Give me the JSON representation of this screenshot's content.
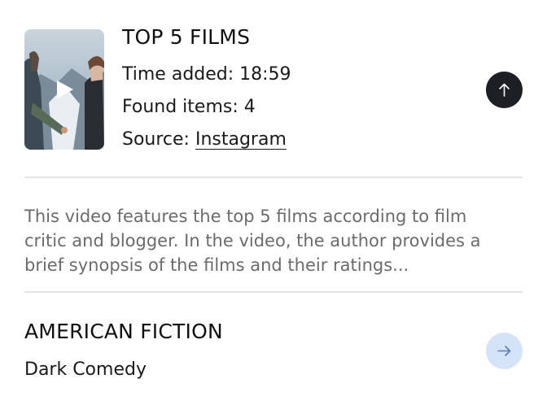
{
  "video": {
    "title": "TOP 5 FILMS",
    "time_added": "Time added: 18:59",
    "found_items": "Found items: 4",
    "source_label": "Source: ",
    "source_link": "Instagram",
    "description": "This video features the top 5 films according to film critic and blogger. In the video, the author provides a brief synopsis of the films and their ratings..."
  },
  "items": [
    {
      "title": "AMERICAN FICTION",
      "genre": "Dark Comedy"
    }
  ],
  "icons": {
    "thumbnail_play": "play-icon",
    "scroll_up": "arrow-up-icon",
    "item_open": "arrow-right-icon"
  },
  "colors": {
    "up_button": "#1d1f24",
    "next_button": "#d4e3f8",
    "next_arrow": "#5b7fb5",
    "description_text": "#6b6b6b",
    "divider": "#e4e4e4"
  }
}
